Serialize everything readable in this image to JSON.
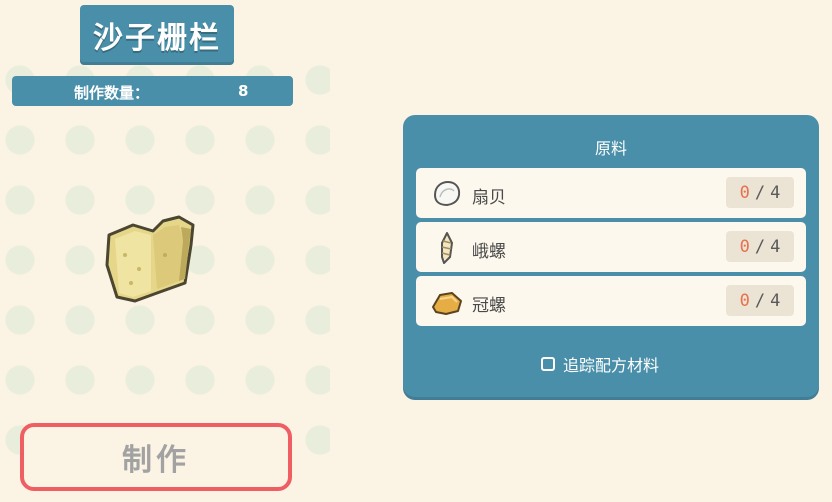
{
  "item": {
    "name": "沙子栅栏",
    "quantity_label": "制作数量：",
    "quantity_value": "8"
  },
  "craft_button": {
    "label": "制作"
  },
  "materials_panel": {
    "title": "原料",
    "items": [
      {
        "name": "扇贝",
        "have": "0",
        "separator": "/",
        "need": "4",
        "icon": "scallop-shell-icon"
      },
      {
        "name": "峨螺",
        "have": "0",
        "separator": "/",
        "need": "4",
        "icon": "whelk-shell-icon"
      },
      {
        "name": "冠螺",
        "have": "0",
        "separator": "/",
        "need": "4",
        "icon": "helmet-shell-icon"
      }
    ],
    "track_label": "追踪配方材料"
  },
  "colors": {
    "panel": "#4a8fa9",
    "background": "#fbf3e4",
    "craft_border": "#ee5e63",
    "count_have": "#e8714e"
  }
}
